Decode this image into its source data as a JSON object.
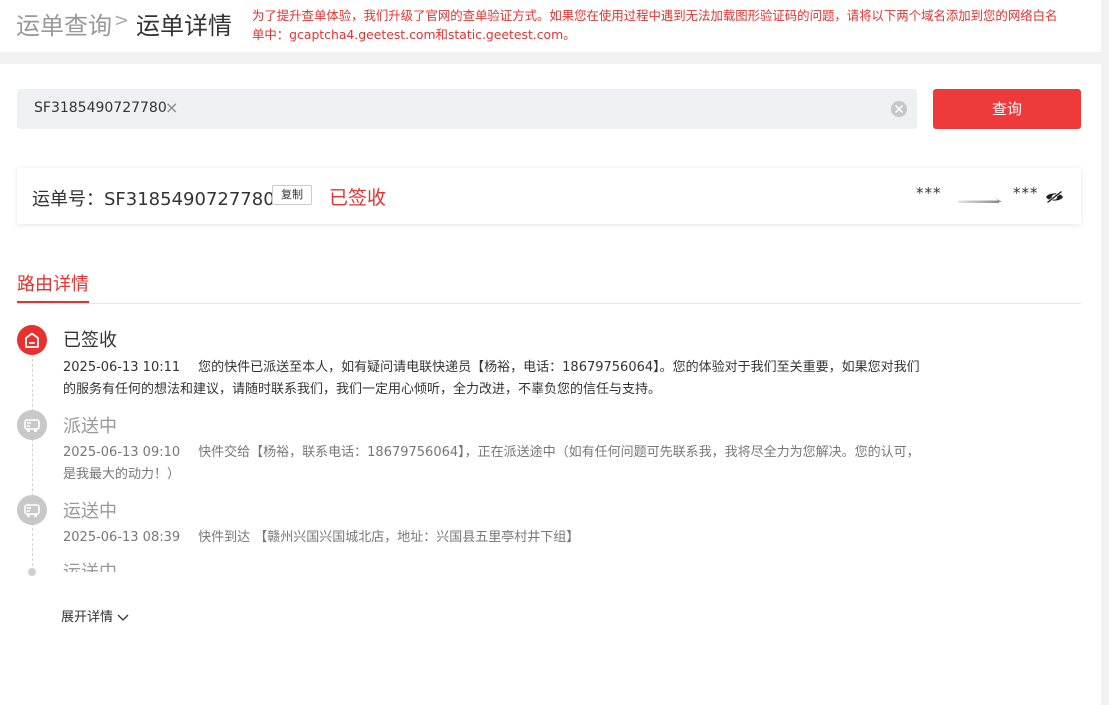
{
  "breadcrumb": {
    "root": "运单查询",
    "separator": ">",
    "current": "运单详情"
  },
  "notice": "为了提升查单体验，我们升级了官网的查单验证方式。如果您在使用过程中遇到无法加载图形验证码的问题，请将以下两个域名添加到您的网络白名单中：gcaptcha4.geetest.com和static.geetest.com。",
  "search": {
    "value": "SF3185490727780",
    "remove_symbol": "×",
    "button_label": "查询"
  },
  "waybill": {
    "label": "运单号：SF3185490727780",
    "copy_label": "复制",
    "status": "已签收",
    "from": "***",
    "to": "***"
  },
  "tab": {
    "title": "路由详情"
  },
  "timeline": [
    {
      "title": "已签收",
      "time": "2025-06-13 10:11",
      "desc": "您的快件已派送至本人，如有疑问请电联快递员【杨裕，电话：18679756064】。您的体验对于我们至关重要，如果您对我们的服务有任何的想法和建议，请随时联系我们，我们一定用心倾听，全力改进，不辜负您的信任与支持。",
      "icon": "signed-icon"
    },
    {
      "title": "派送中",
      "time": "2025-06-13 09:10",
      "desc": "快件交给【杨裕，联系电话：18679756064】，正在派送途中（如有任何问题可先联系我，我将尽全力为您解决。您的认可，是我最大的动力！）",
      "icon": "delivery-truck-icon"
    },
    {
      "title": "运送中",
      "time": "2025-06-13 08:39",
      "desc": "快件到达 【赣州兴国兴国城北店，地址：兴国县五里亭村井下组】",
      "icon": "transit-truck-icon"
    },
    {
      "title": "运送中"
    }
  ],
  "expand_label": "展开详情",
  "colors": {
    "accent": "#e8312f",
    "button": "#ee3a3a",
    "muted_icon": "#c8c8c8"
  }
}
